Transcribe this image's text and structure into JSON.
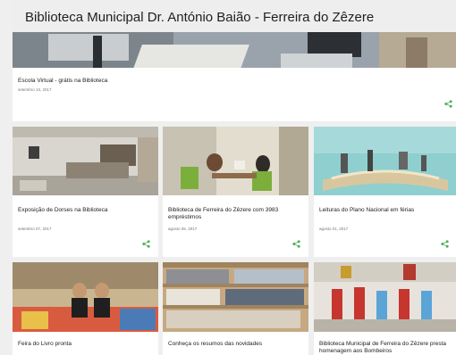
{
  "header": {
    "title": "Biblioteca Municipal Dr. António Baião - Ferreira do Zêzere"
  },
  "colors": {
    "share": "#4caf50",
    "background": "#efefef",
    "card": "#ffffff"
  },
  "posts": [
    {
      "title": "Escola Virtual - grátis na Biblioteca",
      "date": "setembro 13, 2017"
    },
    {
      "title": "Exposição de Dorses na Biblioteca",
      "date": "setembro 07, 2017"
    },
    {
      "title": "Biblioteca de Ferreira do Zêzere com 3983 empréstimos",
      "date": "agosto 05, 2017"
    },
    {
      "title": "Leituras do Plano Nacional em férias",
      "date": "agosto 01, 2017"
    },
    {
      "title": "Feira do Livro pronta",
      "date": ""
    },
    {
      "title": "Conheça os resumos das novidades",
      "date": ""
    },
    {
      "title": "Biblioteca Municipal de Ferreira do Zêzere presta homenagem aos Bombeiros",
      "date": ""
    }
  ],
  "icons": {
    "share": "share-icon"
  }
}
